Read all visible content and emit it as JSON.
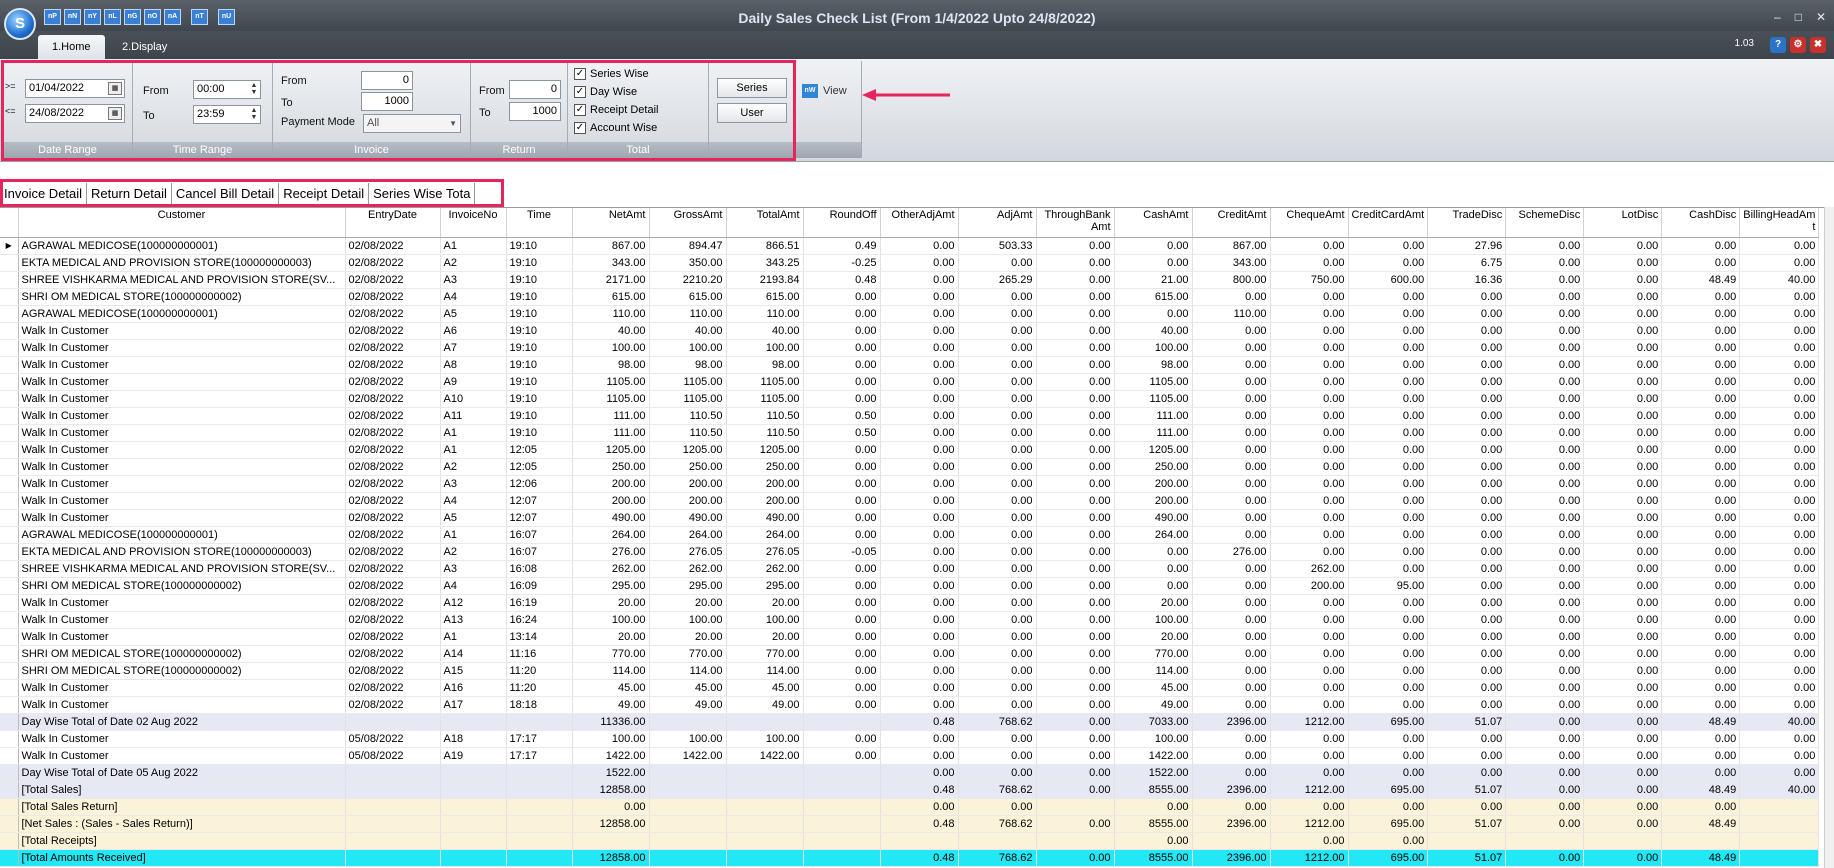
{
  "window": {
    "title": "Daily Sales Check List (From 1/4/2022 Upto 24/8/2022)",
    "version": "1.03",
    "logo": "S"
  },
  "qat": [
    {
      "label": "nP"
    },
    {
      "label": "nN"
    },
    {
      "label": "nY"
    },
    {
      "label": "nL"
    },
    {
      "label": "nG"
    },
    {
      "label": "nO"
    },
    {
      "label": "nA"
    },
    {
      "label": "nT"
    },
    {
      "label": "nU"
    }
  ],
  "ribbon_tabs": [
    "1.Home",
    "2.Display"
  ],
  "date_range": {
    "op_from": ">=",
    "op_to": "<=",
    "from": "01/04/2022",
    "to": "24/08/2022",
    "caption": "Date Range"
  },
  "time_range": {
    "from_label": "From",
    "to_label": "To",
    "from": "00:00",
    "to": "23:59",
    "caption": "Time Range"
  },
  "invoice": {
    "from_label": "From",
    "to_label": "To",
    "from": "0",
    "to": "1000",
    "payment_mode_label": "Payment Mode",
    "payment_mode": "All",
    "caption": "Invoice"
  },
  "return": {
    "from_label": "From",
    "to_label": "To",
    "from": "0",
    "to": "1000",
    "caption": "Return"
  },
  "totals": {
    "caption": "Total",
    "options": [
      {
        "label": "Series Wise",
        "checked": true
      },
      {
        "label": "Day Wise",
        "checked": true
      },
      {
        "label": "Receipt Detail",
        "checked": true
      },
      {
        "label": "Account Wise",
        "checked": true
      }
    ]
  },
  "buttons": {
    "series": "Series",
    "user": "User",
    "view": "View"
  },
  "grid_tabs": [
    "Invoice Detail",
    "Return Detail",
    "Cancel Bill Detail",
    "Receipt Detail",
    "Series Wise Tota"
  ],
  "columns": [
    "Customer",
    "EntryDate",
    "InvoiceNo",
    "Time",
    "NetAmt",
    "GrossAmt",
    "TotalAmt",
    "RoundOff",
    "OtherAdjAmt",
    "AdjAmt",
    "ThroughBank Amt",
    "CashAmt",
    "CreditAmt",
    "ChequeAmt",
    "CreditCardAmt",
    "TradeDisc",
    "SchemeDisc",
    "LotDisc",
    "CashDisc",
    "BillingHeadAm t"
  ],
  "rows": [
    {
      "type": "data",
      "current": true,
      "cells": [
        "AGRAWAL MEDICOSE(100000000001)",
        "02/08/2022",
        "A1",
        "19:10",
        "867.00",
        "894.47",
        "866.51",
        "0.49",
        "0.00",
        "503.33",
        "0.00",
        "0.00",
        "867.00",
        "0.00",
        "0.00",
        "27.96",
        "0.00",
        "0.00",
        "0.00",
        "0.00"
      ]
    },
    {
      "type": "data",
      "cells": [
        "EKTA MEDICAL AND PROVISION STORE(100000000003)",
        "02/08/2022",
        "A2",
        "19:10",
        "343.00",
        "350.00",
        "343.25",
        "-0.25",
        "0.00",
        "0.00",
        "0.00",
        "0.00",
        "343.00",
        "0.00",
        "0.00",
        "6.75",
        "0.00",
        "0.00",
        "0.00",
        "0.00"
      ]
    },
    {
      "type": "data",
      "cells": [
        "SHREE VISHKARMA MEDICAL AND PROVISION STORE(SV...",
        "02/08/2022",
        "A3",
        "19:10",
        "2171.00",
        "2210.20",
        "2193.84",
        "0.48",
        "0.00",
        "265.29",
        "0.00",
        "21.00",
        "800.00",
        "750.00",
        "600.00",
        "16.36",
        "0.00",
        "0.00",
        "48.49",
        "40.00"
      ]
    },
    {
      "type": "data",
      "cells": [
        "SHRI OM MEDICAL STORE(100000000002)",
        "02/08/2022",
        "A4",
        "19:10",
        "615.00",
        "615.00",
        "615.00",
        "0.00",
        "0.00",
        "0.00",
        "0.00",
        "615.00",
        "0.00",
        "0.00",
        "0.00",
        "0.00",
        "0.00",
        "0.00",
        "0.00",
        "0.00"
      ]
    },
    {
      "type": "data",
      "cells": [
        "AGRAWAL MEDICOSE(100000000001)",
        "02/08/2022",
        "A5",
        "19:10",
        "110.00",
        "110.00",
        "110.00",
        "0.00",
        "0.00",
        "0.00",
        "0.00",
        "0.00",
        "110.00",
        "0.00",
        "0.00",
        "0.00",
        "0.00",
        "0.00",
        "0.00",
        "0.00"
      ]
    },
    {
      "type": "data",
      "cells": [
        "Walk In Customer",
        "02/08/2022",
        "A6",
        "19:10",
        "40.00",
        "40.00",
        "40.00",
        "0.00",
        "0.00",
        "0.00",
        "0.00",
        "40.00",
        "0.00",
        "0.00",
        "0.00",
        "0.00",
        "0.00",
        "0.00",
        "0.00",
        "0.00"
      ]
    },
    {
      "type": "data",
      "cells": [
        "Walk In Customer",
        "02/08/2022",
        "A7",
        "19:10",
        "100.00",
        "100.00",
        "100.00",
        "0.00",
        "0.00",
        "0.00",
        "0.00",
        "100.00",
        "0.00",
        "0.00",
        "0.00",
        "0.00",
        "0.00",
        "0.00",
        "0.00",
        "0.00"
      ]
    },
    {
      "type": "data",
      "cells": [
        "Walk In Customer",
        "02/08/2022",
        "A8",
        "19:10",
        "98.00",
        "98.00",
        "98.00",
        "0.00",
        "0.00",
        "0.00",
        "0.00",
        "98.00",
        "0.00",
        "0.00",
        "0.00",
        "0.00",
        "0.00",
        "0.00",
        "0.00",
        "0.00"
      ]
    },
    {
      "type": "data",
      "cells": [
        "Walk In Customer",
        "02/08/2022",
        "A9",
        "19:10",
        "1105.00",
        "1105.00",
        "1105.00",
        "0.00",
        "0.00",
        "0.00",
        "0.00",
        "1105.00",
        "0.00",
        "0.00",
        "0.00",
        "0.00",
        "0.00",
        "0.00",
        "0.00",
        "0.00"
      ]
    },
    {
      "type": "data",
      "cells": [
        "Walk In Customer",
        "02/08/2022",
        "A10",
        "19:10",
        "1105.00",
        "1105.00",
        "1105.00",
        "0.00",
        "0.00",
        "0.00",
        "0.00",
        "1105.00",
        "0.00",
        "0.00",
        "0.00",
        "0.00",
        "0.00",
        "0.00",
        "0.00",
        "0.00"
      ]
    },
    {
      "type": "data",
      "cells": [
        "Walk In Customer",
        "02/08/2022",
        "A11",
        "19:10",
        "111.00",
        "110.50",
        "110.50",
        "0.50",
        "0.00",
        "0.00",
        "0.00",
        "111.00",
        "0.00",
        "0.00",
        "0.00",
        "0.00",
        "0.00",
        "0.00",
        "0.00",
        "0.00"
      ]
    },
    {
      "type": "data",
      "cells": [
        "Walk In Customer",
        "02/08/2022",
        "A1",
        "19:10",
        "111.00",
        "110.50",
        "110.50",
        "0.50",
        "0.00",
        "0.00",
        "0.00",
        "111.00",
        "0.00",
        "0.00",
        "0.00",
        "0.00",
        "0.00",
        "0.00",
        "0.00",
        "0.00"
      ]
    },
    {
      "type": "data",
      "cells": [
        "Walk In Customer",
        "02/08/2022",
        "A1",
        "12:05",
        "1205.00",
        "1205.00",
        "1205.00",
        "0.00",
        "0.00",
        "0.00",
        "0.00",
        "1205.00",
        "0.00",
        "0.00",
        "0.00",
        "0.00",
        "0.00",
        "0.00",
        "0.00",
        "0.00"
      ]
    },
    {
      "type": "data",
      "cells": [
        "Walk In Customer",
        "02/08/2022",
        "A2",
        "12:05",
        "250.00",
        "250.00",
        "250.00",
        "0.00",
        "0.00",
        "0.00",
        "0.00",
        "250.00",
        "0.00",
        "0.00",
        "0.00",
        "0.00",
        "0.00",
        "0.00",
        "0.00",
        "0.00"
      ]
    },
    {
      "type": "data",
      "cells": [
        "Walk In Customer",
        "02/08/2022",
        "A3",
        "12:06",
        "200.00",
        "200.00",
        "200.00",
        "0.00",
        "0.00",
        "0.00",
        "0.00",
        "200.00",
        "0.00",
        "0.00",
        "0.00",
        "0.00",
        "0.00",
        "0.00",
        "0.00",
        "0.00"
      ]
    },
    {
      "type": "data",
      "cells": [
        "Walk In Customer",
        "02/08/2022",
        "A4",
        "12:07",
        "200.00",
        "200.00",
        "200.00",
        "0.00",
        "0.00",
        "0.00",
        "0.00",
        "200.00",
        "0.00",
        "0.00",
        "0.00",
        "0.00",
        "0.00",
        "0.00",
        "0.00",
        "0.00"
      ]
    },
    {
      "type": "data",
      "cells": [
        "Walk In Customer",
        "02/08/2022",
        "A5",
        "12:07",
        "490.00",
        "490.00",
        "490.00",
        "0.00",
        "0.00",
        "0.00",
        "0.00",
        "490.00",
        "0.00",
        "0.00",
        "0.00",
        "0.00",
        "0.00",
        "0.00",
        "0.00",
        "0.00"
      ]
    },
    {
      "type": "data",
      "cells": [
        "AGRAWAL MEDICOSE(100000000001)",
        "02/08/2022",
        "A1",
        "16:07",
        "264.00",
        "264.00",
        "264.00",
        "0.00",
        "0.00",
        "0.00",
        "0.00",
        "264.00",
        "0.00",
        "0.00",
        "0.00",
        "0.00",
        "0.00",
        "0.00",
        "0.00",
        "0.00"
      ]
    },
    {
      "type": "data",
      "cells": [
        "EKTA MEDICAL AND PROVISION STORE(100000000003)",
        "02/08/2022",
        "A2",
        "16:07",
        "276.00",
        "276.05",
        "276.05",
        "-0.05",
        "0.00",
        "0.00",
        "0.00",
        "0.00",
        "276.00",
        "0.00",
        "0.00",
        "0.00",
        "0.00",
        "0.00",
        "0.00",
        "0.00"
      ]
    },
    {
      "type": "data",
      "cells": [
        "SHREE VISHKARMA MEDICAL AND PROVISION STORE(SV...",
        "02/08/2022",
        "A3",
        "16:08",
        "262.00",
        "262.00",
        "262.00",
        "0.00",
        "0.00",
        "0.00",
        "0.00",
        "0.00",
        "0.00",
        "262.00",
        "0.00",
        "0.00",
        "0.00",
        "0.00",
        "0.00",
        "0.00"
      ]
    },
    {
      "type": "data",
      "cells": [
        "SHRI OM MEDICAL STORE(100000000002)",
        "02/08/2022",
        "A4",
        "16:09",
        "295.00",
        "295.00",
        "295.00",
        "0.00",
        "0.00",
        "0.00",
        "0.00",
        "0.00",
        "0.00",
        "200.00",
        "95.00",
        "0.00",
        "0.00",
        "0.00",
        "0.00",
        "0.00"
      ]
    },
    {
      "type": "data",
      "cells": [
        "Walk In Customer",
        "02/08/2022",
        "A12",
        "16:19",
        "20.00",
        "20.00",
        "20.00",
        "0.00",
        "0.00",
        "0.00",
        "0.00",
        "20.00",
        "0.00",
        "0.00",
        "0.00",
        "0.00",
        "0.00",
        "0.00",
        "0.00",
        "0.00"
      ]
    },
    {
      "type": "data",
      "cells": [
        "Walk In Customer",
        "02/08/2022",
        "A13",
        "16:24",
        "100.00",
        "100.00",
        "100.00",
        "0.00",
        "0.00",
        "0.00",
        "0.00",
        "100.00",
        "0.00",
        "0.00",
        "0.00",
        "0.00",
        "0.00",
        "0.00",
        "0.00",
        "0.00"
      ]
    },
    {
      "type": "data",
      "cells": [
        "Walk In Customer",
        "02/08/2022",
        "A1",
        "13:14",
        "20.00",
        "20.00",
        "20.00",
        "0.00",
        "0.00",
        "0.00",
        "0.00",
        "20.00",
        "0.00",
        "0.00",
        "0.00",
        "0.00",
        "0.00",
        "0.00",
        "0.00",
        "0.00"
      ]
    },
    {
      "type": "data",
      "cells": [
        "SHRI OM MEDICAL STORE(100000000002)",
        "02/08/2022",
        "A14",
        "11:16",
        "770.00",
        "770.00",
        "770.00",
        "0.00",
        "0.00",
        "0.00",
        "0.00",
        "770.00",
        "0.00",
        "0.00",
        "0.00",
        "0.00",
        "0.00",
        "0.00",
        "0.00",
        "0.00"
      ]
    },
    {
      "type": "data",
      "cells": [
        "SHRI OM MEDICAL STORE(100000000002)",
        "02/08/2022",
        "A15",
        "11:20",
        "114.00",
        "114.00",
        "114.00",
        "0.00",
        "0.00",
        "0.00",
        "0.00",
        "114.00",
        "0.00",
        "0.00",
        "0.00",
        "0.00",
        "0.00",
        "0.00",
        "0.00",
        "0.00"
      ]
    },
    {
      "type": "data",
      "cells": [
        "Walk In Customer",
        "02/08/2022",
        "A16",
        "11:20",
        "45.00",
        "45.00",
        "45.00",
        "0.00",
        "0.00",
        "0.00",
        "0.00",
        "45.00",
        "0.00",
        "0.00",
        "0.00",
        "0.00",
        "0.00",
        "0.00",
        "0.00",
        "0.00"
      ]
    },
    {
      "type": "data",
      "cells": [
        "Walk In Customer",
        "02/08/2022",
        "A17",
        "18:18",
        "49.00",
        "49.00",
        "49.00",
        "0.00",
        "0.00",
        "0.00",
        "0.00",
        "49.00",
        "0.00",
        "0.00",
        "0.00",
        "0.00",
        "0.00",
        "0.00",
        "0.00",
        "0.00"
      ]
    },
    {
      "type": "daytot",
      "cells": [
        "Day Wise Total of Date 02 Aug 2022",
        "",
        "",
        "",
        "11336.00",
        "",
        "",
        "",
        "0.48",
        "768.62",
        "0.00",
        "7033.00",
        "2396.00",
        "1212.00",
        "695.00",
        "51.07",
        "0.00",
        "0.00",
        "48.49",
        "40.00"
      ]
    },
    {
      "type": "data",
      "cells": [
        "Walk In Customer",
        "05/08/2022",
        "A18",
        "17:17",
        "100.00",
        "100.00",
        "100.00",
        "0.00",
        "0.00",
        "0.00",
        "0.00",
        "100.00",
        "0.00",
        "0.00",
        "0.00",
        "0.00",
        "0.00",
        "0.00",
        "0.00",
        "0.00"
      ]
    },
    {
      "type": "data",
      "cells": [
        "Walk In Customer",
        "05/08/2022",
        "A19",
        "17:17",
        "1422.00",
        "1422.00",
        "1422.00",
        "0.00",
        "0.00",
        "0.00",
        "0.00",
        "1422.00",
        "0.00",
        "0.00",
        "0.00",
        "0.00",
        "0.00",
        "0.00",
        "0.00",
        "0.00"
      ]
    },
    {
      "type": "daytot",
      "cells": [
        "Day Wise Total of Date 05 Aug 2022",
        "",
        "",
        "",
        "1522.00",
        "",
        "",
        "",
        "0.00",
        "0.00",
        "0.00",
        "1522.00",
        "0.00",
        "0.00",
        "0.00",
        "0.00",
        "0.00",
        "0.00",
        "0.00",
        "0.00"
      ]
    },
    {
      "type": "daytot",
      "cells": [
        "[Total Sales]",
        "",
        "",
        "",
        "12858.00",
        "",
        "",
        "",
        "0.48",
        "768.62",
        "0.00",
        "8555.00",
        "2396.00",
        "1212.00",
        "695.00",
        "51.07",
        "0.00",
        "0.00",
        "48.49",
        "40.00"
      ]
    },
    {
      "type": "sumrow",
      "cells": [
        "[Total Sales Return]",
        "",
        "",
        "",
        "0.00",
        "",
        "",
        "",
        "0.00",
        "0.00",
        "",
        "0.00",
        "0.00",
        "0.00",
        "0.00",
        "0.00",
        "0.00",
        "0.00",
        "0.00",
        ""
      ]
    },
    {
      "type": "sumrow",
      "cells": [
        "[Net Sales : (Sales - Sales Return)]",
        "",
        "",
        "",
        "12858.00",
        "",
        "",
        "",
        "0.48",
        "768.62",
        "0.00",
        "8555.00",
        "2396.00",
        "1212.00",
        "695.00",
        "51.07",
        "0.00",
        "0.00",
        "48.49",
        ""
      ]
    },
    {
      "type": "sumrow",
      "cells": [
        "[Total Receipts]",
        "",
        "",
        "",
        "",
        "",
        "",
        "",
        "",
        "",
        "",
        "0.00",
        "",
        "0.00",
        "0.00",
        "",
        "",
        "",
        "",
        ""
      ]
    },
    {
      "type": "grand",
      "cells": [
        "[Total Amounts Received]",
        "",
        "",
        "",
        "12858.00",
        "",
        "",
        "",
        "0.48",
        "768.62",
        "0.00",
        "8555.00",
        "2396.00",
        "1212.00",
        "695.00",
        "51.07",
        "0.00",
        "0.00",
        "48.49",
        ""
      ]
    }
  ]
}
